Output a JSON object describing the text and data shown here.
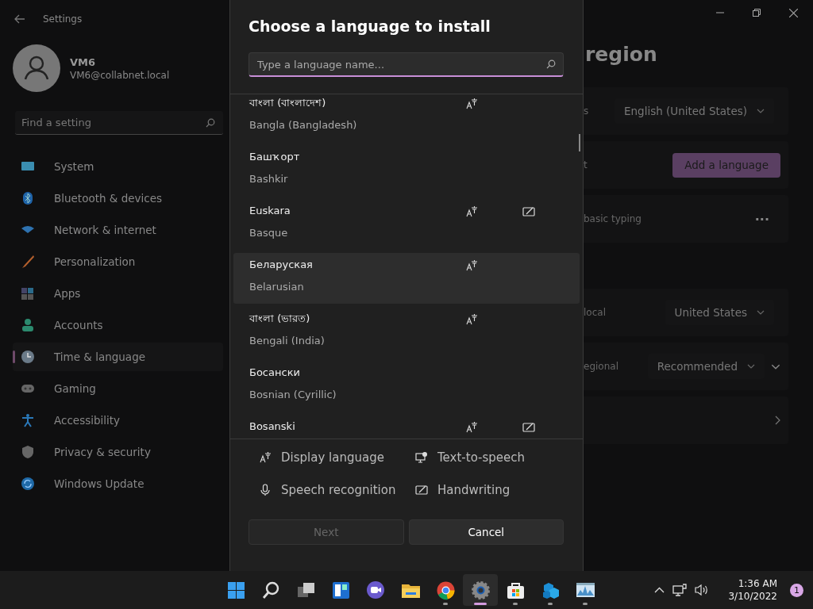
{
  "settings_window": {
    "title": "Settings",
    "user": {
      "name": "VM6",
      "email": "VM6@collabnet.local"
    },
    "search": {
      "placeholder": "Find a setting"
    },
    "nav": [
      {
        "label": "System",
        "kind": "system",
        "selected": false
      },
      {
        "label": "Bluetooth & devices",
        "kind": "bluetooth",
        "selected": false
      },
      {
        "label": "Network & internet",
        "kind": "network",
        "selected": false
      },
      {
        "label": "Personalization",
        "kind": "brush",
        "selected": false
      },
      {
        "label": "Apps",
        "kind": "apps",
        "selected": false
      },
      {
        "label": "Accounts",
        "kind": "accounts",
        "selected": false
      },
      {
        "label": "Time & language",
        "kind": "time",
        "selected": true
      },
      {
        "label": "Gaming",
        "kind": "gaming",
        "selected": false
      },
      {
        "label": "Accessibility",
        "kind": "accessibility",
        "selected": false
      },
      {
        "label": "Privacy & security",
        "kind": "shield",
        "selected": false
      },
      {
        "label": "Windows Update",
        "kind": "update",
        "selected": false
      }
    ],
    "page_title": "region",
    "cards": [
      {
        "label": "s",
        "kind": "dropdown",
        "value": "English (United States)"
      },
      {
        "label": "t",
        "kind": "button",
        "value": "Add a language"
      },
      {
        "label": "basic typing",
        "kind": "more",
        "value": "···"
      },
      {
        "label": "local",
        "kind": "dropdown",
        "value": "United States",
        "gap": true
      },
      {
        "label": "egional",
        "kind": "dropdown_expand",
        "value": "Recommended"
      },
      {
        "kind": "link"
      }
    ]
  },
  "dialog": {
    "title": "Choose a language to install",
    "search": {
      "placeholder": "Type a language name..."
    },
    "languages": [
      {
        "native": "বাংলা (বাংলাদেশ)",
        "english": "Bangla (Bangladesh)",
        "display_language": true,
        "handwriting": false,
        "hovered": false
      },
      {
        "native": "Башҡорт",
        "english": "Bashkir",
        "display_language": false,
        "handwriting": false,
        "hovered": false
      },
      {
        "native": "Euskara",
        "english": "Basque",
        "display_language": true,
        "handwriting": true,
        "hovered": false
      },
      {
        "native": "Беларуская",
        "english": "Belarusian",
        "display_language": true,
        "handwriting": false,
        "hovered": true
      },
      {
        "native": "বাংলা (ভারত)",
        "english": "Bengali (India)",
        "display_language": true,
        "handwriting": false,
        "hovered": false
      },
      {
        "native": "Босански",
        "english": "Bosnian (Cyrillic)",
        "display_language": false,
        "handwriting": false,
        "hovered": false
      },
      {
        "native": "Bosanski",
        "display_language": true,
        "handwriting": true,
        "hovered": false
      }
    ],
    "legend": [
      {
        "kind": "display",
        "label": "Display language"
      },
      {
        "kind": "tts",
        "label": "Text-to-speech"
      },
      {
        "kind": "speech",
        "label": "Speech recognition"
      },
      {
        "kind": "handwriting",
        "label": "Handwriting"
      }
    ],
    "buttons": [
      {
        "label": "Next",
        "disabled": true
      },
      {
        "label": "Cancel",
        "disabled": false
      }
    ]
  },
  "taskbar": {
    "apps": [
      {
        "kind": "start",
        "running": false,
        "active": false
      },
      {
        "kind": "search",
        "running": false,
        "active": false
      },
      {
        "kind": "taskview",
        "running": false,
        "active": false
      },
      {
        "kind": "widgets",
        "running": false,
        "active": false
      },
      {
        "kind": "chat",
        "running": false,
        "active": false
      },
      {
        "kind": "folder",
        "running": false,
        "active": false
      },
      {
        "kind": "browser",
        "running": true,
        "active": false
      },
      {
        "kind": "settings",
        "running": true,
        "active": true
      },
      {
        "kind": "store",
        "running": true,
        "active": false
      },
      {
        "kind": "cubes",
        "running": true,
        "active": false
      },
      {
        "kind": "monitor",
        "running": true,
        "active": false
      }
    ],
    "time": "1:36 AM",
    "date": "3/10/2022",
    "notifications": "1"
  }
}
